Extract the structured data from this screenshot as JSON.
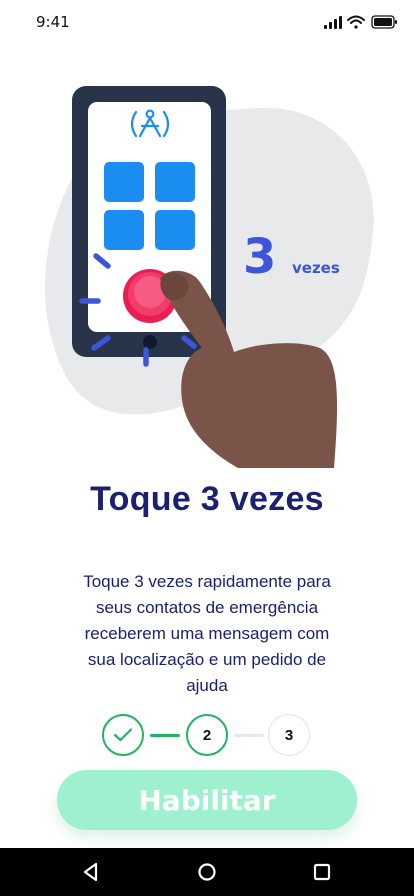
{
  "status_bar": {
    "time": "9:41",
    "icons": [
      "signal-icon",
      "wifi-icon",
      "battery-icon"
    ]
  },
  "illustration": {
    "badge_number": "3",
    "badge_word": "vezes",
    "icons": [
      "phone-icon",
      "app-logo-icon",
      "app-tile-icon",
      "panic-button-icon",
      "hand-icon"
    ]
  },
  "title": "Toque 3 vezes",
  "description": "Toque 3 vezes rapidamente para seus contatos de emergência receberem uma mensagem com sua localização e um pedido de ajuda",
  "stepper": {
    "steps": [
      {
        "label": "",
        "state": "completed",
        "icon": "check-icon"
      },
      {
        "label": "2",
        "state": "current"
      },
      {
        "label": "3",
        "state": "upcoming"
      }
    ]
  },
  "primary_button": {
    "label": "Habilitar"
  },
  "nav_bar": {
    "buttons": [
      "back-icon",
      "home-icon",
      "recents-icon"
    ]
  },
  "colors": {
    "title": "#1b2170",
    "accent_green": "#1fb560",
    "button_bg": "#9ef0cf",
    "badge_blue": "#3c55d9",
    "app_tile_blue": "#1b8cf0",
    "panic_red": "#f22b5c",
    "skin": "#7a5448"
  }
}
